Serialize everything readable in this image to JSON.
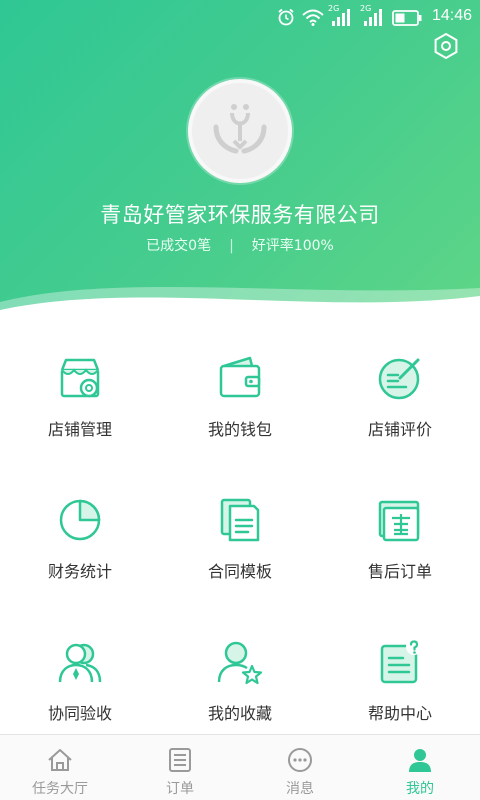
{
  "status_bar": {
    "time": "14:46",
    "network_1": "2G",
    "network_2": "2G",
    "icons": [
      "alarm-icon",
      "wifi-icon",
      "signal-icon",
      "signal-icon",
      "battery-icon"
    ]
  },
  "colors": {
    "brand": "#2fc795",
    "brand_light": "#5fd687",
    "text_dark": "#333333",
    "tab_inactive": "#9a9a9a"
  },
  "profile": {
    "company_name": "青岛好管家环保服务有限公司",
    "deals": "已成交0笔",
    "separator": "|",
    "rating": "好评率100%"
  },
  "menu": {
    "items": [
      {
        "label": "店铺管理",
        "icon": "store-settings-icon"
      },
      {
        "label": "我的钱包",
        "icon": "wallet-icon"
      },
      {
        "label": "店铺评价",
        "icon": "review-icon"
      },
      {
        "label": "财务统计",
        "icon": "pie-chart-icon"
      },
      {
        "label": "合同模板",
        "icon": "document-icon"
      },
      {
        "label": "售后订单",
        "icon": "after-sales-icon"
      },
      {
        "label": "协同验收",
        "icon": "team-icon"
      },
      {
        "label": "我的收藏",
        "icon": "favorite-user-icon"
      },
      {
        "label": "帮助中心",
        "icon": "help-icon"
      }
    ]
  },
  "tabs": [
    {
      "label": "任务大厅",
      "icon": "home-icon",
      "active": false
    },
    {
      "label": "订单",
      "icon": "order-list-icon",
      "active": false
    },
    {
      "label": "消息",
      "icon": "message-icon",
      "active": false
    },
    {
      "label": "我的",
      "icon": "profile-icon",
      "active": true
    }
  ]
}
